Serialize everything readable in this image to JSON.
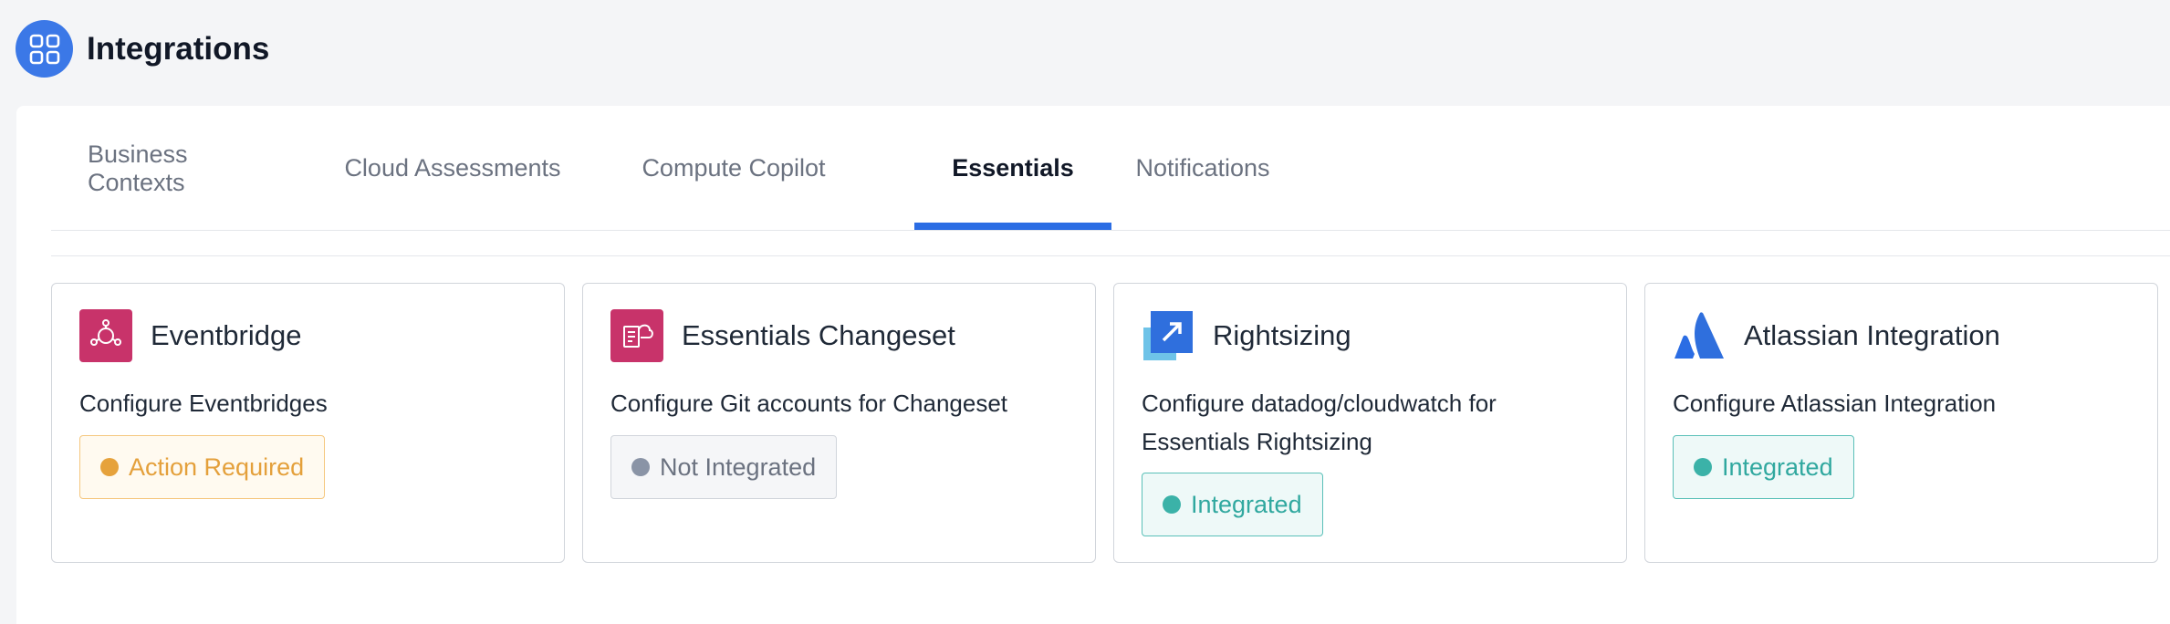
{
  "header": {
    "title": "Integrations",
    "icon": "grid-icon",
    "accent": "#3b78e7"
  },
  "tabs": [
    {
      "label": "Business Contexts",
      "active": false
    },
    {
      "label": "Cloud Assessments",
      "active": false
    },
    {
      "label": "Compute Copilot",
      "active": false
    },
    {
      "label": "Essentials",
      "active": true
    },
    {
      "label": "Notifications",
      "active": false
    }
  ],
  "cards": [
    {
      "title": "Eventbridge",
      "icon": "eventbridge-icon",
      "description": "Configure Eventbridges",
      "status": "Action Required",
      "status_color": "#e6a23c"
    },
    {
      "title": "Essentials Changeset",
      "icon": "changeset-icon",
      "description": "Configure Git accounts for Changeset",
      "status": "Not Integrated",
      "status_color": "#8a94a6"
    },
    {
      "title": "Rightsizing",
      "icon": "rightsizing-icon",
      "description": "Configure datadog/cloudwatch for Essentials Rightsizing",
      "status": "Integrated",
      "status_color": "#3bb2a8"
    },
    {
      "title": "Atlassian Integration",
      "icon": "atlassian-icon",
      "description": "Configure Atlassian Integration",
      "status": "Integrated",
      "status_color": "#3bb2a8"
    }
  ]
}
